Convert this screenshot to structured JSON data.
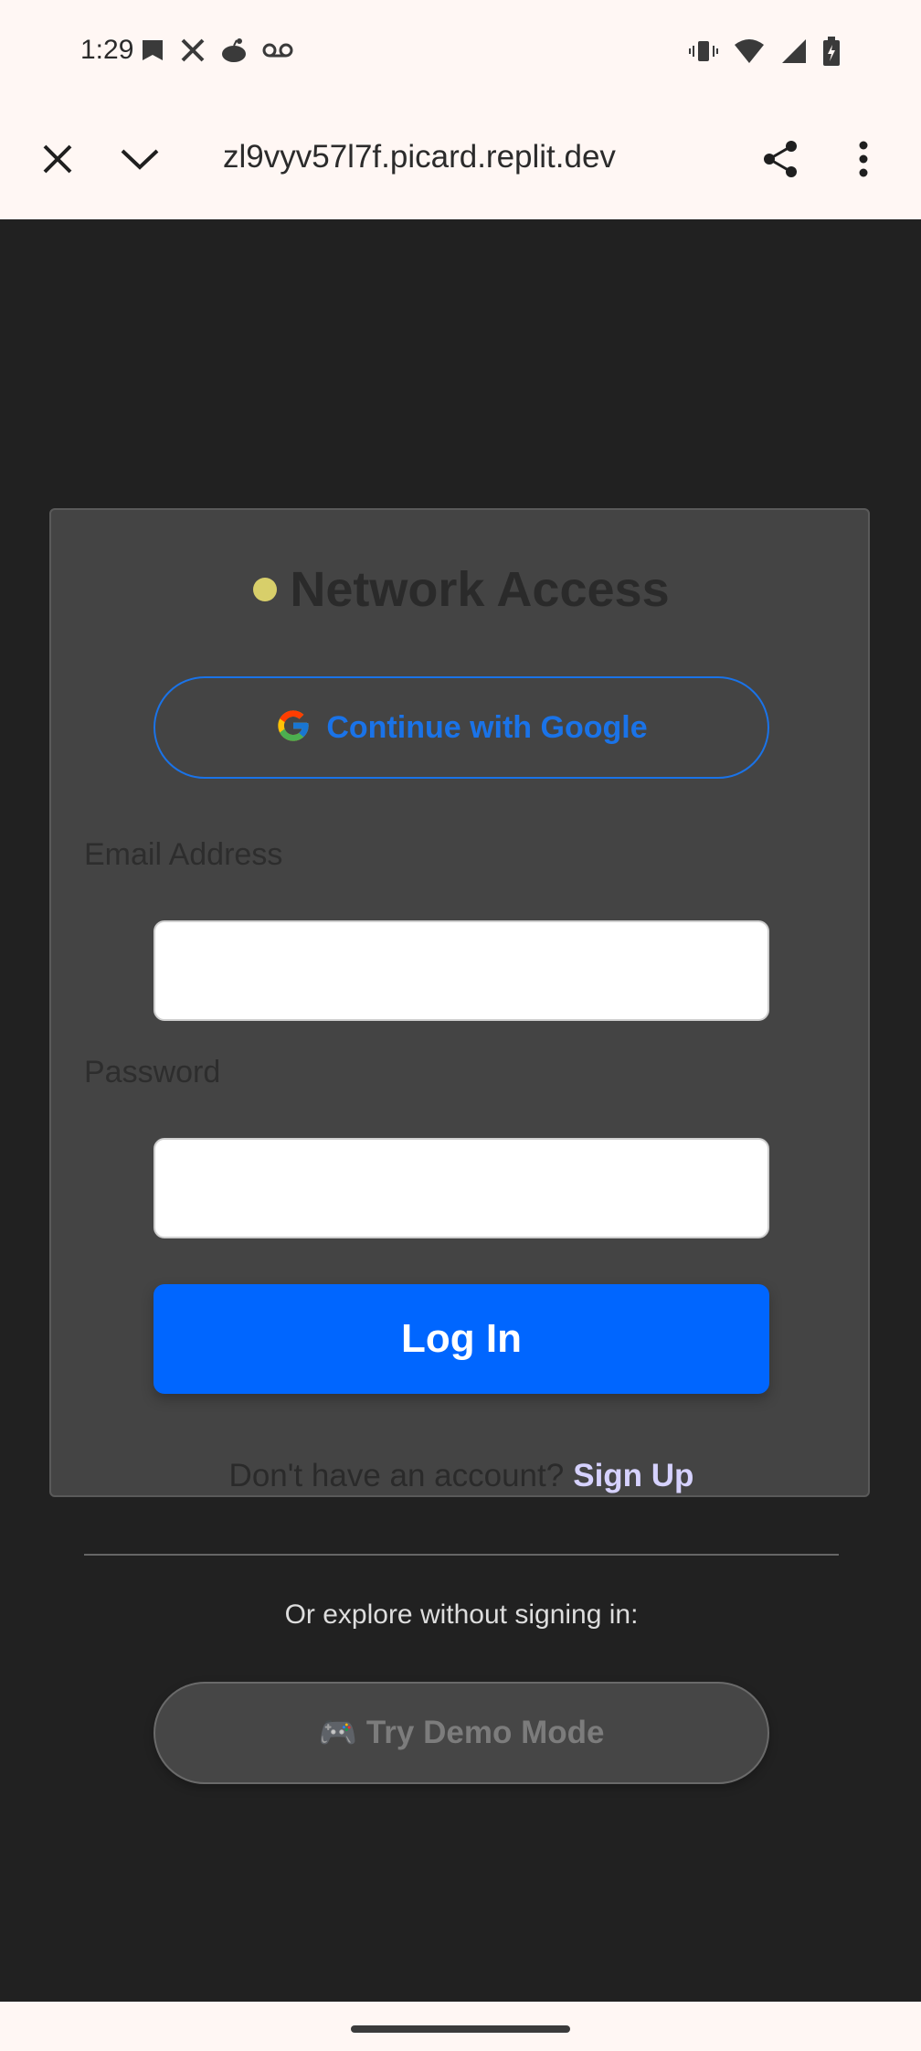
{
  "status_bar": {
    "time": "1:29",
    "left_icons": [
      "notification-icon",
      "x-app-icon",
      "reddit-icon",
      "voicemail-icon"
    ],
    "right_icons": [
      "vibrate-icon",
      "wifi-icon",
      "cell-signal-icon",
      "battery-icon"
    ]
  },
  "browser": {
    "url": "zl9vyv57l7f.picard.replit.dev",
    "buttons": [
      "close-icon",
      "chevron-down-icon",
      "share-icon",
      "more-vert-icon"
    ]
  },
  "login_card": {
    "title": "Network Access",
    "google_button_label": "Continue with Google",
    "email_label": "Email Address",
    "email_value": "",
    "password_label": "Password",
    "password_value": "",
    "login_button_label": "Log In",
    "signup_prompt": "Don't have an account?",
    "signup_link": "Sign Up",
    "explore_text": "Or explore without signing in:",
    "demo_icon": "🎮",
    "demo_button_label": "Try Demo Mode"
  },
  "colors": {
    "page_background": "#212121",
    "card_background": "#444444",
    "primary_blue": "#0066ff",
    "google_blue": "#1a73e8",
    "title_dot": "#d8cf6a",
    "signup_link": "#d6d2ff"
  }
}
